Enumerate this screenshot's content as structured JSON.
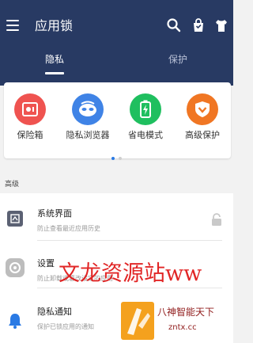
{
  "header": {
    "title": "应用锁",
    "tabs": [
      {
        "label": "隐私",
        "active": true
      },
      {
        "label": "保护",
        "active": false
      }
    ],
    "icons": [
      "search-icon",
      "bag-icon",
      "shirt-icon"
    ]
  },
  "features": [
    {
      "label": "保险箱",
      "icon": "safe-icon",
      "color": "#ef5350"
    },
    {
      "label": "隐私浏览器",
      "icon": "mask-icon",
      "color": "#3f83e6"
    },
    {
      "label": "省电模式",
      "icon": "battery-icon",
      "color": "#1fbf5f"
    },
    {
      "label": "高级保护",
      "icon": "shield-icon",
      "color": "#f07623"
    }
  ],
  "pager": {
    "active_index": 0,
    "count": 2
  },
  "section_label": "高级",
  "settings": [
    {
      "title": "系统界面",
      "subtitle": "防止查看最近应用历史",
      "icon": "recent-apps-icon",
      "trailing": "lock-icon"
    },
    {
      "title": "设置",
      "subtitle": "防止卸载或篡改设定的应用",
      "icon": "settings-icon"
    },
    {
      "title": "隐私通知",
      "subtitle": "保护已锁应用的通知",
      "icon": "bell-icon"
    }
  ],
  "watermark": {
    "text": "文龙资源站ww",
    "badge_title": "八神智能天下",
    "badge_url": "zntx.cc"
  },
  "colors": {
    "header": "#283a63",
    "accent_blue": "#2a7ae4",
    "watermark_red": "#e01a1a"
  }
}
